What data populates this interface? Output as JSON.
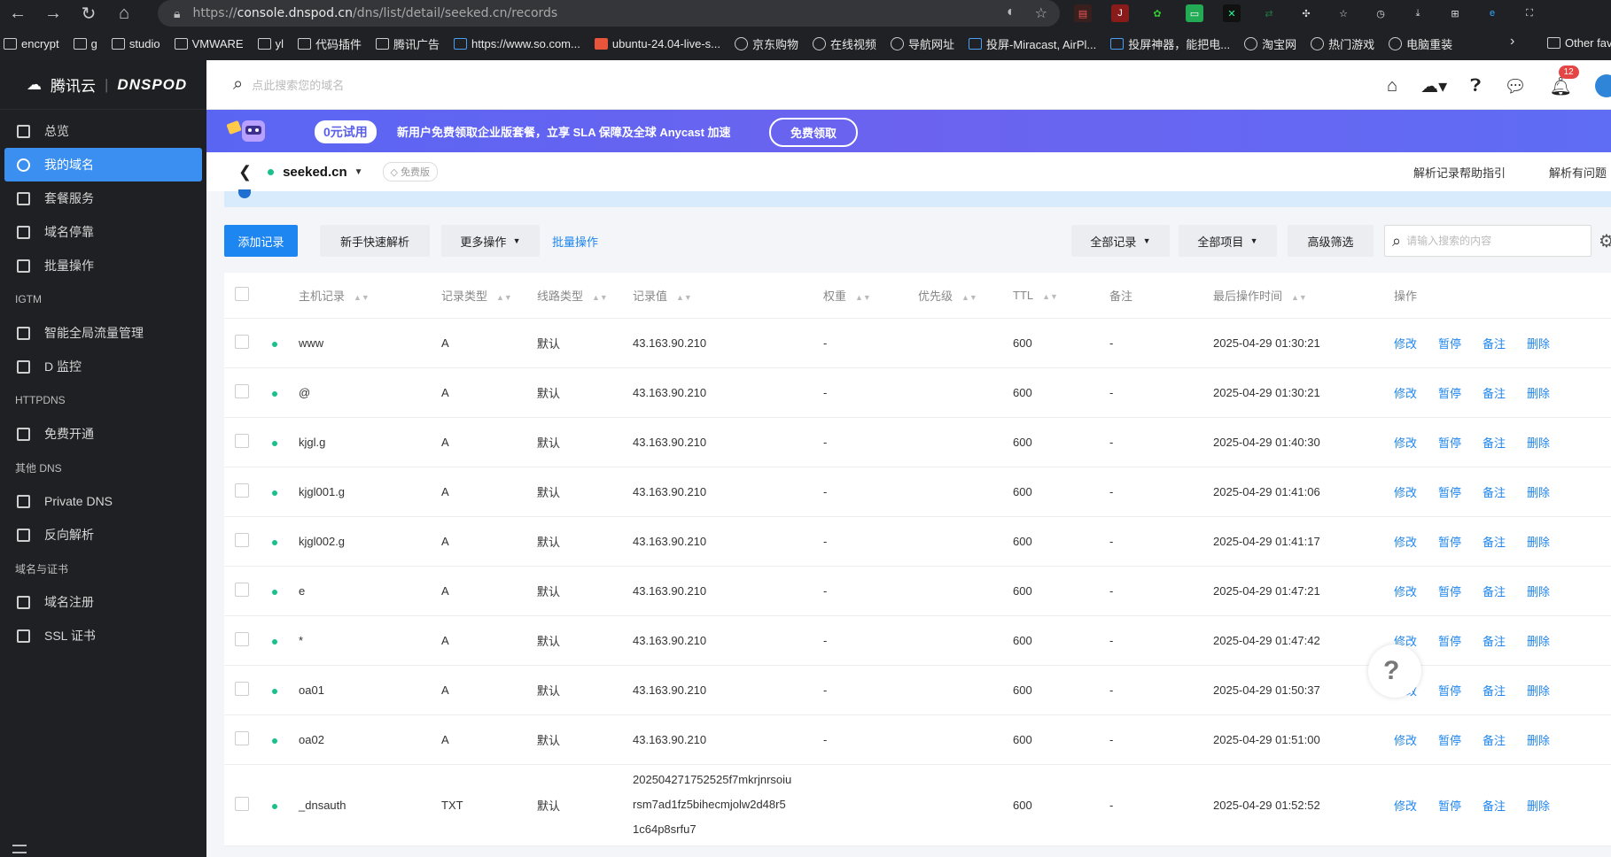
{
  "browser": {
    "url_prefix": "https://",
    "url_host": "console.dnspod.cn",
    "url_path": "/dns/list/detail/seeked.cn/records",
    "bookmarks": [
      "encrypt",
      "g",
      "studio",
      "VMWARE",
      "yl",
      "代码插件",
      "腾讯广告",
      "https://www.so.com...",
      "ubuntu-24.04-live-s...",
      "京东购物",
      "在线视频",
      "导航网址",
      "投屏-Miracast, AirPl...",
      "投屏神器，能把电...",
      "淘宝网",
      "热门游戏",
      "电脑重装"
    ],
    "other_bookmarks": "Other fav"
  },
  "sidebar": {
    "brand": "腾讯云",
    "product": "DNSPOD",
    "items": [
      {
        "label": "总览",
        "type": "item"
      },
      {
        "label": "我的域名",
        "type": "item",
        "active": true
      },
      {
        "label": "套餐服务",
        "type": "item"
      },
      {
        "label": "域名停靠",
        "type": "item"
      },
      {
        "label": "批量操作",
        "type": "item"
      },
      {
        "label": "IGTM",
        "type": "group"
      },
      {
        "label": "智能全局流量管理",
        "type": "item"
      },
      {
        "label": "D 监控",
        "type": "item"
      },
      {
        "label": "HTTPDNS",
        "type": "group"
      },
      {
        "label": "免费开通",
        "type": "item"
      },
      {
        "label": "其他 DNS",
        "type": "group"
      },
      {
        "label": "Private DNS",
        "type": "item"
      },
      {
        "label": "反向解析",
        "type": "item"
      },
      {
        "label": "域名与证书",
        "type": "group"
      },
      {
        "label": "域名注册",
        "type": "item"
      },
      {
        "label": "SSL 证书",
        "type": "item"
      }
    ]
  },
  "topbar": {
    "search_placeholder": "点此搜索您的域名",
    "notification_count": "12"
  },
  "banner": {
    "trial": "0元试用",
    "text": "新用户免费领取企业版套餐，立享 SLA 保障及全球 Anycast 加速",
    "cta": "免费领取"
  },
  "domain": {
    "name": "seeked.cn",
    "plan": "免费版",
    "help_link": "解析记录帮助指引",
    "help_link2": "解析有问题"
  },
  "toolbar": {
    "add_record": "添加记录",
    "quick_resolve": "新手快速解析",
    "more_actions": "更多操作",
    "batch": "批量操作",
    "all_records": "全部记录",
    "all_items": "全部项目",
    "advanced_filter": "高级筛选",
    "search_placeholder": "请输入搜索的内容"
  },
  "table": {
    "columns": [
      "主机记录",
      "记录类型",
      "线路类型",
      "记录值",
      "权重",
      "优先级",
      "TTL",
      "备注",
      "最后操作时间",
      "操作"
    ],
    "actions": [
      "修改",
      "暂停",
      "备注",
      "删除"
    ],
    "rows": [
      {
        "host": "www",
        "type": "A",
        "line": "默认",
        "value": "43.163.90.210",
        "weight": "-",
        "ttl": "600",
        "remark": "-",
        "time": "2025-04-29 01:30:21"
      },
      {
        "host": "@",
        "type": "A",
        "line": "默认",
        "value": "43.163.90.210",
        "weight": "-",
        "ttl": "600",
        "remark": "-",
        "time": "2025-04-29 01:30:21"
      },
      {
        "host": "kjgl.g",
        "type": "A",
        "line": "默认",
        "value": "43.163.90.210",
        "weight": "-",
        "ttl": "600",
        "remark": "-",
        "time": "2025-04-29 01:40:30"
      },
      {
        "host": "kjgl001.g",
        "type": "A",
        "line": "默认",
        "value": "43.163.90.210",
        "weight": "-",
        "ttl": "600",
        "remark": "-",
        "time": "2025-04-29 01:41:06"
      },
      {
        "host": "kjgl002.g",
        "type": "A",
        "line": "默认",
        "value": "43.163.90.210",
        "weight": "-",
        "ttl": "600",
        "remark": "-",
        "time": "2025-04-29 01:41:17"
      },
      {
        "host": "e",
        "type": "A",
        "line": "默认",
        "value": "43.163.90.210",
        "weight": "-",
        "ttl": "600",
        "remark": "-",
        "time": "2025-04-29 01:47:21"
      },
      {
        "host": "*",
        "type": "A",
        "line": "默认",
        "value": "43.163.90.210",
        "weight": "-",
        "ttl": "600",
        "remark": "-",
        "time": "2025-04-29 01:47:42"
      },
      {
        "host": "oa01",
        "type": "A",
        "line": "默认",
        "value": "43.163.90.210",
        "weight": "-",
        "ttl": "600",
        "remark": "-",
        "time": "2025-04-29 01:50:37"
      },
      {
        "host": "oa02",
        "type": "A",
        "line": "默认",
        "value": "43.163.90.210",
        "weight": "-",
        "ttl": "600",
        "remark": "-",
        "time": "2025-04-29 01:51:00"
      },
      {
        "host": "_dnsauth",
        "type": "TXT",
        "line": "默认",
        "value_lines": [
          "202504271752525f7mkrjnrsoiu",
          "rsm7ad1fz5bihecmjolw2d48r5",
          "1c64p8srfu7"
        ],
        "weight": "",
        "ttl": "600",
        "remark": "-",
        "time": "2025-04-29 01:52:52"
      }
    ]
  },
  "colors": {
    "accent": "#1e86f0",
    "sidebar": "#1f2023",
    "active": "#3a8ff0",
    "status": "#1ac08c"
  }
}
